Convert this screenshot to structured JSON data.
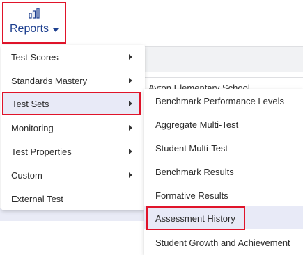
{
  "header": {
    "reports_label": "Reports",
    "reports_icon": "bar-chart-icon"
  },
  "background": {
    "school_name": "Ayton Elementary School"
  },
  "menu": {
    "items": [
      {
        "label": "Test Scores",
        "has_submenu": true
      },
      {
        "label": "Standards Mastery",
        "has_submenu": true
      },
      {
        "label": "Test Sets",
        "has_submenu": true,
        "active": true
      },
      {
        "label": "Monitoring",
        "has_submenu": true
      },
      {
        "label": "Test Properties",
        "has_submenu": true
      },
      {
        "label": "Custom",
        "has_submenu": true
      },
      {
        "label": "External Test",
        "has_submenu": false
      }
    ]
  },
  "submenu": {
    "items": [
      {
        "label": "Benchmark Performance Levels"
      },
      {
        "label": "Aggregate Multi-Test"
      },
      {
        "label": "Student Multi-Test"
      },
      {
        "label": "Benchmark Results"
      },
      {
        "label": "Formative Results"
      },
      {
        "label": "Assessment History",
        "active": true
      },
      {
        "label": "Student Growth and Achievement"
      }
    ]
  },
  "colors": {
    "accent_blue": "#1d3f8f",
    "highlight_red": "#e0142a",
    "active_bg": "#e8eaf7"
  }
}
